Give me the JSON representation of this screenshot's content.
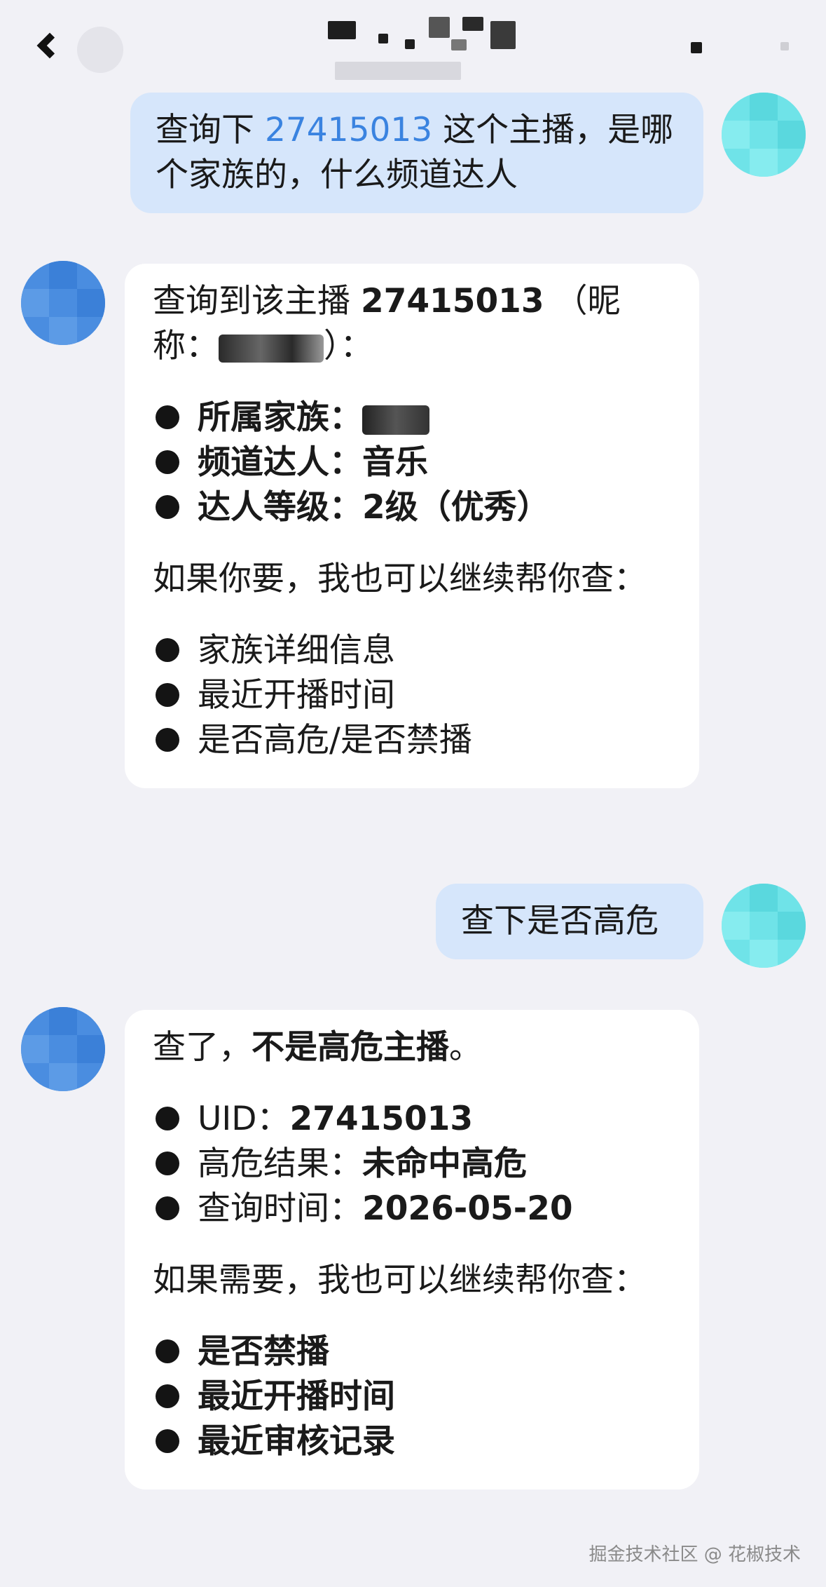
{
  "header": {
    "title_redacted": true,
    "back_icon": "chevron-left-icon"
  },
  "messages": {
    "m1": {
      "role": "user",
      "prefix": "查询下 ",
      "id_text": "27415013 ",
      "suffix": "这个主播，是哪个家族的，什么频道达人"
    },
    "m2": {
      "role": "bot",
      "intro_a": "查询到该主播 ",
      "intro_id": "27415013",
      "intro_b": " （昵称：",
      "intro_c": "）：",
      "items": [
        {
          "label": "所属家族：",
          "value": ""
        },
        {
          "label": "频道达人：",
          "value": "音乐"
        },
        {
          "label": "达人等级：",
          "value": "2级（优秀）"
        }
      ],
      "followup": "如果你要，我也可以继续帮你查：",
      "options": [
        "家族详细信息",
        "最近开播时间",
        "是否高危/是否禁播"
      ]
    },
    "m3": {
      "role": "user",
      "text": "查下是否高危"
    },
    "m4": {
      "role": "bot",
      "intro_a": "查了，",
      "intro_b": "不是高危主播",
      "intro_c": "。",
      "items": [
        {
          "label": "UID：",
          "value": "27415013"
        },
        {
          "label": "高危结果：",
          "value": "未命中高危"
        },
        {
          "label": "查询时间：",
          "value": "2026-05-20"
        }
      ],
      "followup": "如果需要，我也可以继续帮你查：",
      "options": [
        "是否禁播",
        "最近开播时间",
        "最近审核记录"
      ]
    }
  },
  "watermark": "掘金技术社区 @ 花椒技术",
  "colors": {
    "background": "#f1f1f6",
    "user_bubble": "#d6e6fb",
    "bot_bubble": "#ffffff",
    "link_blue": "#3a83e0",
    "user_avatar": "#6fe3e8",
    "bot_avatar": "#4a8de0"
  }
}
